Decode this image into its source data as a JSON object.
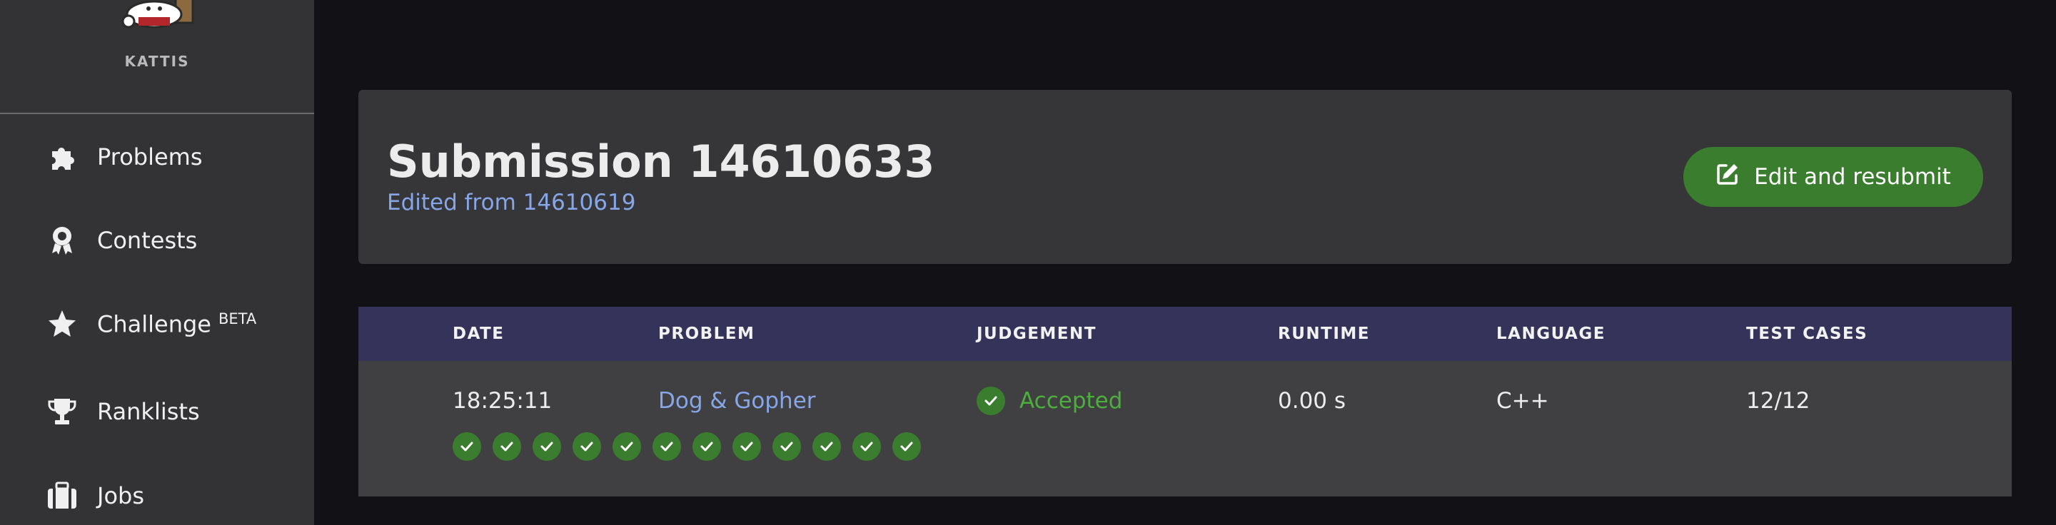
{
  "sidebar": {
    "brand_name": "KATTIS",
    "items": [
      {
        "label": "Problems",
        "icon": "puzzle-icon"
      },
      {
        "label": "Contests",
        "icon": "award-icon"
      },
      {
        "label": "Challenge",
        "icon": "star-icon",
        "badge": "BETA"
      },
      {
        "label": "Ranklists",
        "icon": "trophy-icon"
      },
      {
        "label": "Jobs",
        "icon": "briefcase-icon"
      }
    ]
  },
  "submission": {
    "title": "Submission 14610633",
    "edited_from": "Edited from 14610619",
    "resubmit_label": "Edit and resubmit"
  },
  "table": {
    "headers": [
      "DATE",
      "PROBLEM",
      "JUDGEMENT",
      "RUNTIME",
      "LANGUAGE",
      "TEST CASES"
    ],
    "row": {
      "date": "18:25:11",
      "problem": "Dog & Gopher",
      "judgement": "Accepted",
      "runtime": "0.00 s",
      "language": "C++",
      "test_cases": "12/12"
    },
    "test_case_results": [
      "accepted",
      "accepted",
      "accepted",
      "accepted",
      "accepted",
      "accepted",
      "accepted",
      "accepted",
      "accepted",
      "accepted",
      "accepted",
      "accepted"
    ]
  },
  "colors": {
    "accent_green": "#3b7d2e",
    "accepted_text": "#4cae3c",
    "link_blue": "#86a6e8",
    "table_header": "#35335a"
  }
}
